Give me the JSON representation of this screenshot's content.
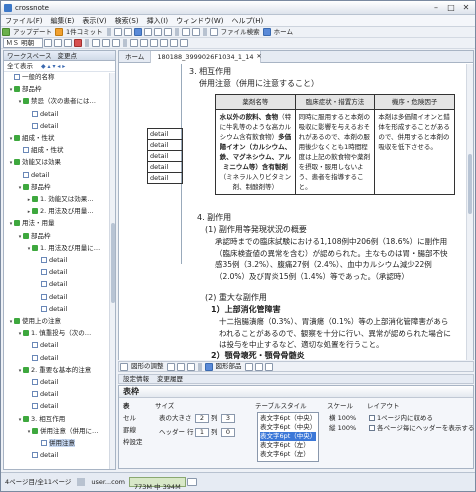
{
  "window": {
    "title": "crossnote"
  },
  "menu": [
    "ファイル(F)",
    "編集(E)",
    "表示(V)",
    "検索(S)",
    "挿入(I)",
    "ウィンドウ(W)",
    "ヘルプ(H)"
  ],
  "toolbar1": {
    "update": "アップデート",
    "commit": "1件コミット"
  },
  "toolbar2": {
    "search": "ファイル検索",
    "home": "ホーム"
  },
  "toolbar3": {
    "font": "ＭＳ 明朝"
  },
  "leftpane": {
    "title": "ワークスペース",
    "changes": "変更点",
    "show_all": "全て表示",
    "tree": [
      {
        "label": "一般的名称",
        "depth": 0,
        "twisty": "",
        "icon": "doc"
      },
      {
        "label": "部品枠",
        "depth": 0,
        "twisty": "▾",
        "icon": "grn"
      },
      {
        "label": "禁忌（次の患者には…",
        "depth": 1,
        "twisty": "▾",
        "icon": "grn"
      },
      {
        "label": "detail",
        "depth": 2,
        "twisty": "",
        "icon": "doc"
      },
      {
        "label": "detail",
        "depth": 2,
        "twisty": "",
        "icon": "doc"
      },
      {
        "label": "組成・性状",
        "depth": 0,
        "twisty": "▾",
        "icon": "grn"
      },
      {
        "label": "組成・性状",
        "depth": 1,
        "twisty": "",
        "icon": "doc"
      },
      {
        "label": "効能又は効果",
        "depth": 0,
        "twisty": "▾",
        "icon": "grn"
      },
      {
        "label": "detail",
        "depth": 1,
        "twisty": "",
        "icon": "doc"
      },
      {
        "label": "部品枠",
        "depth": 1,
        "twisty": "▾",
        "icon": "grn"
      },
      {
        "label": "1. 効能又は効果…",
        "depth": 2,
        "twisty": "▸",
        "icon": "grn"
      },
      {
        "label": "2. 用法及び用量…",
        "depth": 2,
        "twisty": "▸",
        "icon": "grn"
      },
      {
        "label": "用法・用量",
        "depth": 0,
        "twisty": "▾",
        "icon": "grn"
      },
      {
        "label": "部品枠",
        "depth": 1,
        "twisty": "▾",
        "icon": "grn"
      },
      {
        "label": "1. 用法及び用量に…",
        "depth": 2,
        "twisty": "▾",
        "icon": "grn"
      },
      {
        "label": "detail",
        "depth": 3,
        "twisty": "",
        "icon": "doc"
      },
      {
        "label": "detail",
        "depth": 3,
        "twisty": "",
        "icon": "doc"
      },
      {
        "label": "detail",
        "depth": 3,
        "twisty": "",
        "icon": "doc"
      },
      {
        "label": "detail",
        "depth": 3,
        "twisty": "",
        "icon": "doc"
      },
      {
        "label": "detail",
        "depth": 3,
        "twisty": "",
        "icon": "doc"
      },
      {
        "label": "使用上の注意",
        "depth": 0,
        "twisty": "▾",
        "icon": "grn"
      },
      {
        "label": "1. 慎重投与（次の…",
        "depth": 1,
        "twisty": "▾",
        "icon": "grn"
      },
      {
        "label": "detail",
        "depth": 2,
        "twisty": "",
        "icon": "doc"
      },
      {
        "label": "detail",
        "depth": 2,
        "twisty": "",
        "icon": "doc"
      },
      {
        "label": "2. 重要な基本的注意",
        "depth": 1,
        "twisty": "▾",
        "icon": "grn"
      },
      {
        "label": "detail",
        "depth": 2,
        "twisty": "",
        "icon": "doc"
      },
      {
        "label": "detail",
        "depth": 2,
        "twisty": "",
        "icon": "doc"
      },
      {
        "label": "detail",
        "depth": 2,
        "twisty": "",
        "icon": "doc"
      },
      {
        "label": "3. 相互作用",
        "depth": 1,
        "twisty": "▾",
        "icon": "grn"
      },
      {
        "label": "併用注意（併用に…",
        "depth": 2,
        "twisty": "▾",
        "icon": "grn"
      },
      {
        "label": "併用注意",
        "depth": 3,
        "twisty": "",
        "icon": "doc",
        "selected": true
      },
      {
        "label": "detail",
        "depth": 2,
        "twisty": "",
        "icon": "doc"
      }
    ]
  },
  "tabs": [
    {
      "label": "ホーム"
    },
    {
      "label": "180188_3999026F1034_1_14"
    }
  ],
  "document": {
    "h_interaction": "3. 相互作用",
    "h_caution": "併用注意（併用に注意すること）",
    "table_headers": [
      "薬剤名等",
      "臨床症状・措置方法",
      "機序・危険因子"
    ],
    "table_col1_bold": "水以外の飲料、食物",
    "table_col1_normal": "（特に牛乳等のような高カルシウム含有飲食物）",
    "table_col1_bold2": "多価陽イオン（カルシウム、鉄、マグネシウム、アルミニウム等）含有製剤",
    "table_col1_tail": "（ミネラル入りビタミン剤、制酸剤等）",
    "table_col2": "同時に服用すると本剤の吸収に影響を与えるおそれがあるので、本剤の服用後少なくとも1時間程度は上記の飲食物や薬剤を摂取・服用しないよう、患者を指導すること。",
    "table_col3": "本剤は多価陽イオンと錯体を形成することがあるので、併用すると本剤の吸収を低下させる。",
    "inner_rows": [
      "detail",
      "detail",
      "detail",
      "detail",
      "detail"
    ],
    "h_adverse": "4. 副作用",
    "h_summary": "(1) 副作用等発現状況の概要",
    "p_summary": "承認時までの臨床試験における1,108例中206例（18.6%）に副作用（臨床検査値の異常を含む）が認められた。主なものは胃・腸部不快感35例（3.2%）、腹痛27例（2.4%）、血中カルシウム減少22例（2.0%）及び胃炎15例（1.4%）等であった。（承認時）",
    "h_serious": "(2) 重大な副作用",
    "h_ulcer": "1）上部消化管障害",
    "p_ulcer": "十二指腸潰瘍（0.3%）、胃潰瘍（0.1%）等の上部消化管障害があらわれることがあるので、観察を十分に行い、異常が認められた場合には投与を中止するなど、適切な処置を行うこと。",
    "h_jaw": "2）顎骨壊死・顎骨骨髄炎"
  },
  "drawbar": {
    "shape": "図形の調整",
    "parts": "図形部品"
  },
  "propbar": {
    "settings": "設定情報",
    "history": "変更履歴"
  },
  "props": {
    "title": "表枠",
    "side_tabs": [
      "表",
      "セル",
      "罫線",
      "枠設定"
    ],
    "size_label": "サイズ",
    "table_size_label": "表の大きさ",
    "rows_val": "2",
    "rows_unit": "列",
    "cols_val": "3",
    "header_label": "ヘッダー",
    "header_row_label": "行",
    "header_val": "1",
    "header_unit": "列",
    "header_val2": "0",
    "style_label": "テーブルスタイル",
    "styles": [
      "表文字6pt（中央）",
      "表文字6pt（中央）",
      "表文字6pt（中央）",
      "表文字6pt（左）",
      "表文字6pt（左）"
    ],
    "scale_label": "スケール",
    "scale_w": "横 100%",
    "scale_h": "縦 100%",
    "layout_label": "レイアウト",
    "layout_opt1": "1ページ内に収める",
    "layout_opt2": "各ページ毎にヘッダーを表示する"
  },
  "status": {
    "pages": "4ページ目/全11ページ",
    "user": "user...com",
    "memory": "773M 中 394M"
  }
}
